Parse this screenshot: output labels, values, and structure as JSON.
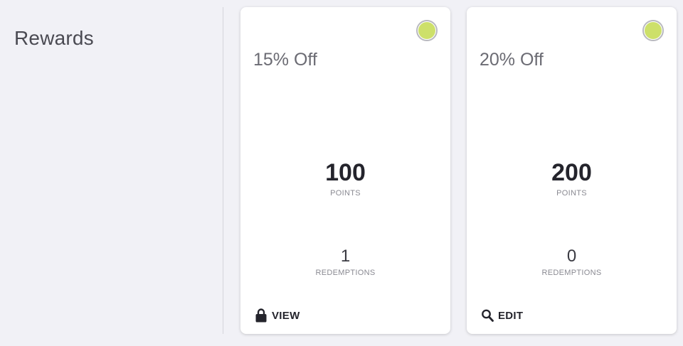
{
  "page": {
    "title": "Rewards"
  },
  "colors": {
    "status_active": "#cde06a",
    "background": "#f1f1f6",
    "card": "#ffffff"
  },
  "rewards": [
    {
      "name": "15% Off",
      "points": "100",
      "points_label": "POINTS",
      "redemptions": "1",
      "redemptions_label": "REDEMPTIONS",
      "action_label": "VIEW",
      "action_icon": "lock-icon",
      "status": "active"
    },
    {
      "name": "20% Off",
      "points": "200",
      "points_label": "POINTS",
      "redemptions": "0",
      "redemptions_label": "REDEMPTIONS",
      "action_label": "EDIT",
      "action_icon": "search-icon",
      "status": "active"
    }
  ]
}
